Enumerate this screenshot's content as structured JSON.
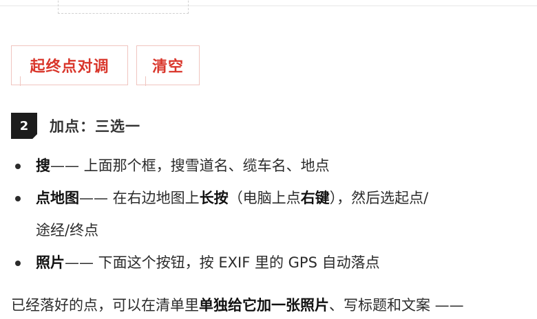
{
  "buttons": {
    "swap": "起终点对调",
    "clear": "清空"
  },
  "step": {
    "number": "2",
    "title": "加点：三选一"
  },
  "options": [
    {
      "bold": "搜",
      "text": "—— 上面那个框，搜雪道名、缆车名、地点"
    },
    {
      "bold": "点地图",
      "text_a": "—— 在右边地图上",
      "bold_b": "长按",
      "text_c": "（电脑上点",
      "bold_d": "右键",
      "text_e": "），然后选起点/",
      "text_f": "途经/终点"
    },
    {
      "bold": "照片",
      "text": "—— 下面这个按钮，按 EXIF 里的 GPS 自动落点"
    }
  ],
  "footer": {
    "text_a": "已经落好的点，可以在清单里",
    "bold_b": "单独给它加一张照片",
    "text_c": "、写标题和文案 ——"
  },
  "colors": {
    "accent": "#d9362b",
    "button_border": "#f0c4bf",
    "badge_bg": "#1c1c1c"
  }
}
